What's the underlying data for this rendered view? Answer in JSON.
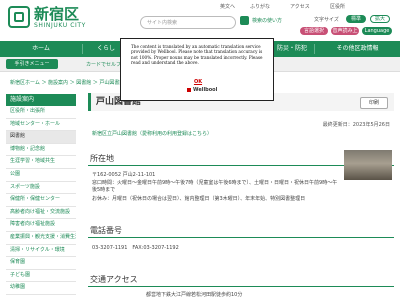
{
  "header": {
    "logo_jp": "新宿区",
    "logo_en": "SHINJUKU CITY",
    "search_placeholder": "サイト内検索",
    "search_tips": "検索の使い方",
    "utility_links": [
      "英文へ",
      "ふりがな",
      "アクセス",
      "区役所"
    ],
    "text_size_label": "文字サイズ",
    "text_size_buttons": [
      "標準",
      "拡大"
    ],
    "color_label": "色合い",
    "lang_buttons": [
      "言語選択",
      "音声読み上げ",
      "Language"
    ]
  },
  "nav": [
    "ホーム",
    "くらし",
    "",
    "",
    "",
    "防災・防犯",
    "その他区政情報"
  ],
  "subbar": {
    "tetsuduki": "手引きメニュー",
    "cardcell": "カードでセルフ"
  },
  "breadcrumb": "新宿区ホーム ＞ 施設案内 ＞ 図書館 ＞ 戸山図書館",
  "sidebar": {
    "heading": "施設案内",
    "items": [
      "区役所・出張所",
      "地域センター・ホール",
      "図書館",
      "博物館・記念館",
      "生涯学習・地域共生",
      "公園",
      "スポーツ施設",
      "保健所・保健センター",
      "高齢者向け福祉・交流施設",
      "障害者向け福祉施設",
      "産業振興・観光支援・消費生活",
      "清掃・リサイクル・環境",
      "保育園",
      "子ども園",
      "幼稚園"
    ]
  },
  "main": {
    "title": "戸山図書館",
    "print": "印刷",
    "updated": "最終更新日：2023年5月26日",
    "translate": "新宿区立戸山図書館（愛称利用の利用登録はこちら）",
    "address_title": "所在地",
    "address_lines": [
      "〒162-0052 戸山2-11-101",
      "窓口時間：火曜日～金曜日午前9時～午後7時（児童室は午後6時まで）、土曜日・日曜日・祝休日午前9時～午後5時まで",
      "お休み：月曜日（祝休日の場合は翌日）、館内整理日（第3木曜日）、年末年始、特別図書整理日"
    ],
    "phone_title": "電話番号",
    "phone_line": "03-3207-1191　FAX:03-3207-1192",
    "access_title": "交通アクセス",
    "access_line": "都営地下鉄大江戸線若松河田駅徒歩約10分"
  },
  "modal": {
    "message": "The content is translated by an automatic translation service provided by Wellbool. Please note that translation accuracy is not 100%. Proper nouns may be translated incorrectly. Please read and understand the above.",
    "ok": "OK",
    "brand": "Wellbool"
  },
  "colors": {
    "brand_green": "#1d8b57",
    "pink": "#c85076"
  }
}
